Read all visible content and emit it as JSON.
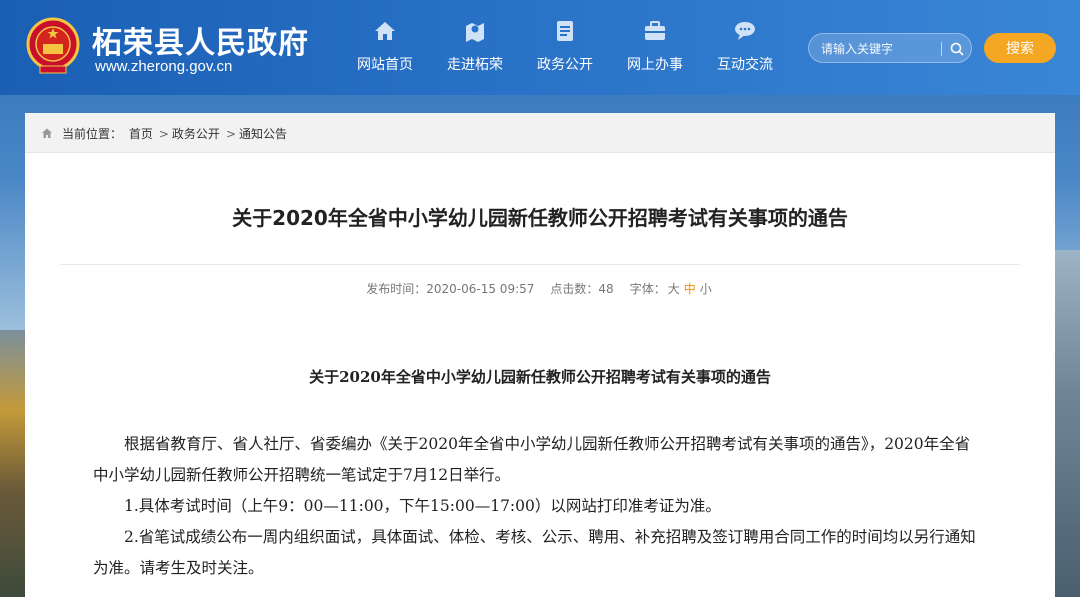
{
  "header": {
    "site_title": "柘荣县人民政府",
    "site_url": "www.zherong.gov.cn",
    "nav": [
      {
        "label": "网站首页",
        "icon": "home-icon"
      },
      {
        "label": "走进柘荣",
        "icon": "map-pin-icon"
      },
      {
        "label": "政务公开",
        "icon": "document-icon"
      },
      {
        "label": "网上办事",
        "icon": "briefcase-icon"
      },
      {
        "label": "互动交流",
        "icon": "chat-icon"
      }
    ],
    "search": {
      "placeholder": "请输入关键字",
      "button_label": "搜索"
    }
  },
  "breadcrumb": {
    "prefix": "当前位置：",
    "items": [
      "首页",
      "政务公开",
      "通知公告"
    ],
    "separator": ">"
  },
  "article": {
    "title": "关于2020年全省中小学幼儿园新任教师公开招聘考试有关事项的通告",
    "meta": {
      "publish_label": "发布时间：",
      "publish_time": "2020-06-15 09:57",
      "clicks_label": "点击数：",
      "clicks": "48",
      "font_label": "字体：",
      "font_sizes": [
        "大",
        "中",
        "小"
      ],
      "active_font_size": "中"
    },
    "content_title": "关于2020年全省中小学幼儿园新任教师公开招聘考试有关事项的通告",
    "paragraphs": [
      "根据省教育厅、省人社厅、省委编办《关于2020年全省中小学幼儿园新任教师公开招聘考试有关事项的通告》，2020年全省中小学幼儿园新任教师公开招聘统一笔试定于7月12日举行。",
      "1.具体考试时间（上午9：00—11:00，下午15:00—17:00）以网站打印准考证为准。",
      "2.省笔试成绩公布一周内组织面试，具体面试、体检、考核、公示、聘用、补充招聘及签订聘用合同工作的时间均以另行通知为准。请考生及时关注。"
    ]
  },
  "colors": {
    "header_blue": "#1a5fb4",
    "search_button": "#f5a623",
    "active_font_size": "#f29100"
  }
}
